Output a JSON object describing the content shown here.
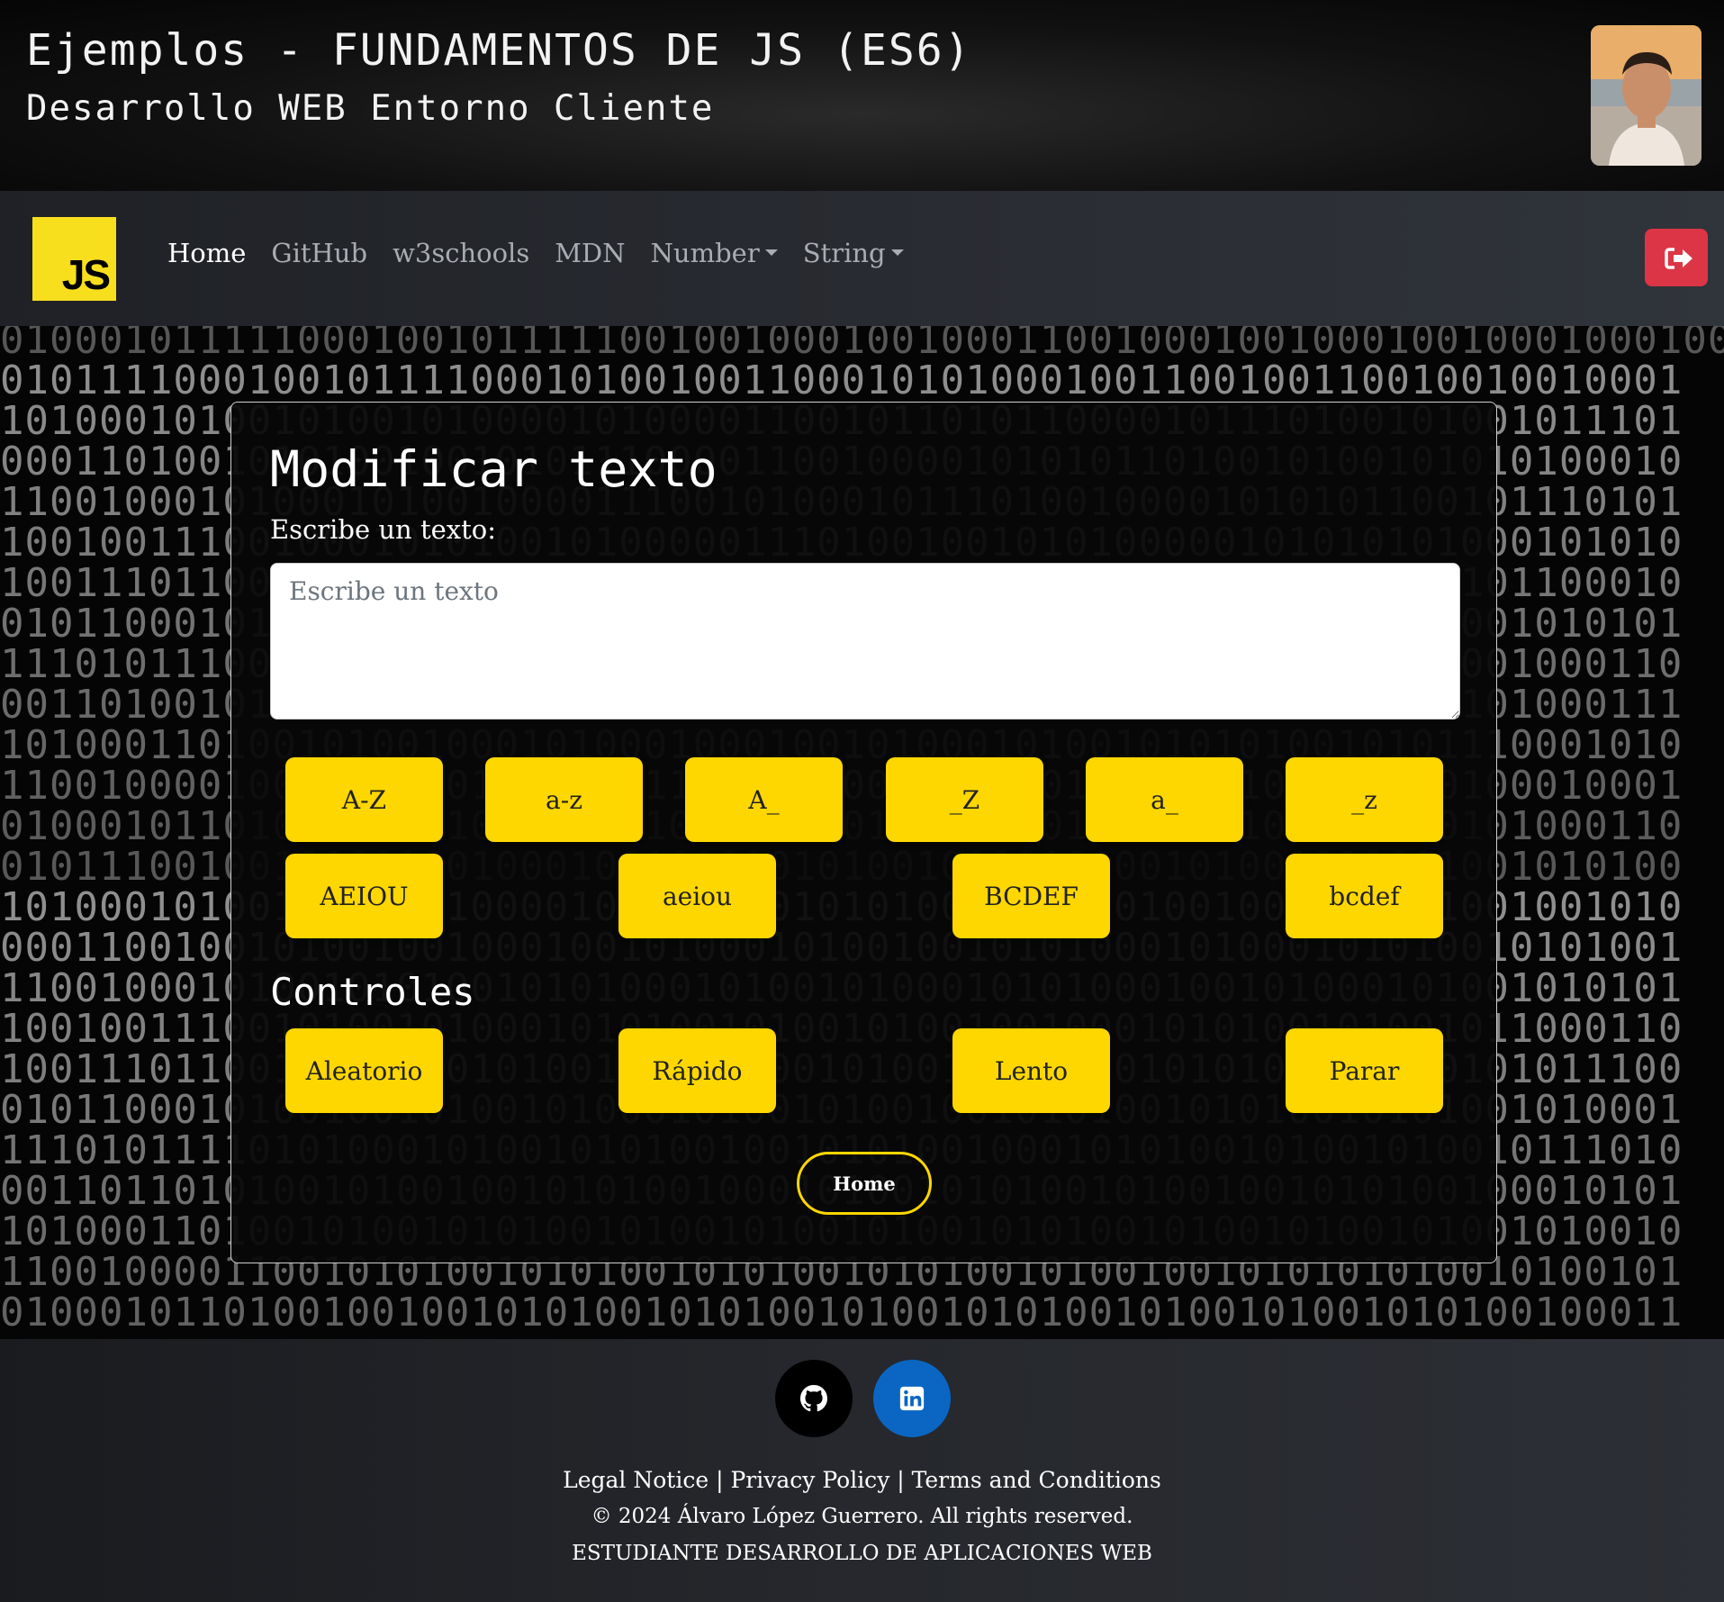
{
  "header": {
    "title": "Ejemplos - FUNDAMENTOS DE JS (ES6)",
    "subtitle": "Desarrollo WEB Entorno Cliente"
  },
  "navbar": {
    "logo_text": "JS",
    "links": [
      {
        "label": "Home",
        "active": true
      },
      {
        "label": "GitHub"
      },
      {
        "label": "w3schools"
      },
      {
        "label": "MDN"
      },
      {
        "label": "Number",
        "dropdown": true
      },
      {
        "label": "String",
        "dropdown": true
      }
    ],
    "logout_icon": "sign-out-icon",
    "logout_color": "#dc3545"
  },
  "background_binary": [
    "0100010111110001001011111001001000100100011001000100100010010001000100",
    "01011110001001011110001010010011000101010001001100100110010010010001",
    "10100010100101001010000101000011001011010110000101110100101001011101",
    "00011010010101001001010111000011001000010101011010010100101010100010",
    "11001000101000101001000011100101000101110100100001010101100101110101",
    "10010011100100010101001010000011101001001010100000101010101000101010",
    "10011101100101001000101010010001001010011000100101001001110101100010",
    "01011000101001000100010001010001010100100101000101000101010001010101",
    "11101011100101000101001000101001000100100101010100010101001001000110",
    "00110100101001010001010001010010010001010010101000100100100101000111",
    "10100011010010100100010100010001001010001010010101010010101110001010",
    "11001000010001000101011100110010000010010101001000101001010100010001",
    "01000101101001001010001010100100010100100101001000101001010101000110",
    "01011100100101001001000100101000101001010010100101001010011001010100",
    "10100010100101001010000100100100101010001010101001001010101001001010",
    "00011001001010010010001001010001010010010101000101000101010010101001",
    "11001000101001010100101010001010010100010101000100101000101001010101",
    "10010011100101001010001010100101001010010010001010100101001011000110",
    "10011101100100100101010010010010010100101000101010101001000101011100",
    "01011000101001001010010100010100101001001010100101010010101001010001",
    "11101011110101000101001010100100101010010001010100101001010010111010",
    "00110110101001010010010101001000101001010100101001001010100100010101",
    "10100011010010100101010010100101001010010101001010010100101001010010",
    "11001000011001010100101010010101001010100101001001010101010010100101",
    "01000101101001001001010100101010010100101010010100101001010100100011"
  ],
  "card": {
    "title": "Modificar texto",
    "label": "Escribe un texto:",
    "textarea_value": "",
    "textarea_placeholder": "Escribe un texto",
    "case_buttons": [
      "A-Z",
      "a-z",
      "A_",
      "_Z",
      "a_",
      "_z"
    ],
    "vowel_buttons": [
      "AEIOU",
      "aeiou",
      "BCDEF",
      "bcdef"
    ],
    "controls_title": "Controles",
    "control_buttons": [
      "Aleatorio",
      "Rápido",
      "Lento",
      "Parar"
    ],
    "home_button": "Home",
    "accent_color": "#ffd700"
  },
  "footer": {
    "social": [
      {
        "icon": "github-icon",
        "color": "#000000"
      },
      {
        "icon": "linkedin-icon",
        "color": "#0a66c2"
      }
    ],
    "legal_notice": "Legal Notice",
    "privacy_policy": "Privacy Policy",
    "terms": "Terms and Conditions",
    "separator": " | ",
    "copyright": "© 2024 Álvaro López Guerrero. All rights reserved.",
    "role": "ESTUDIANTE DESARROLLO DE APLICACIONES WEB"
  }
}
